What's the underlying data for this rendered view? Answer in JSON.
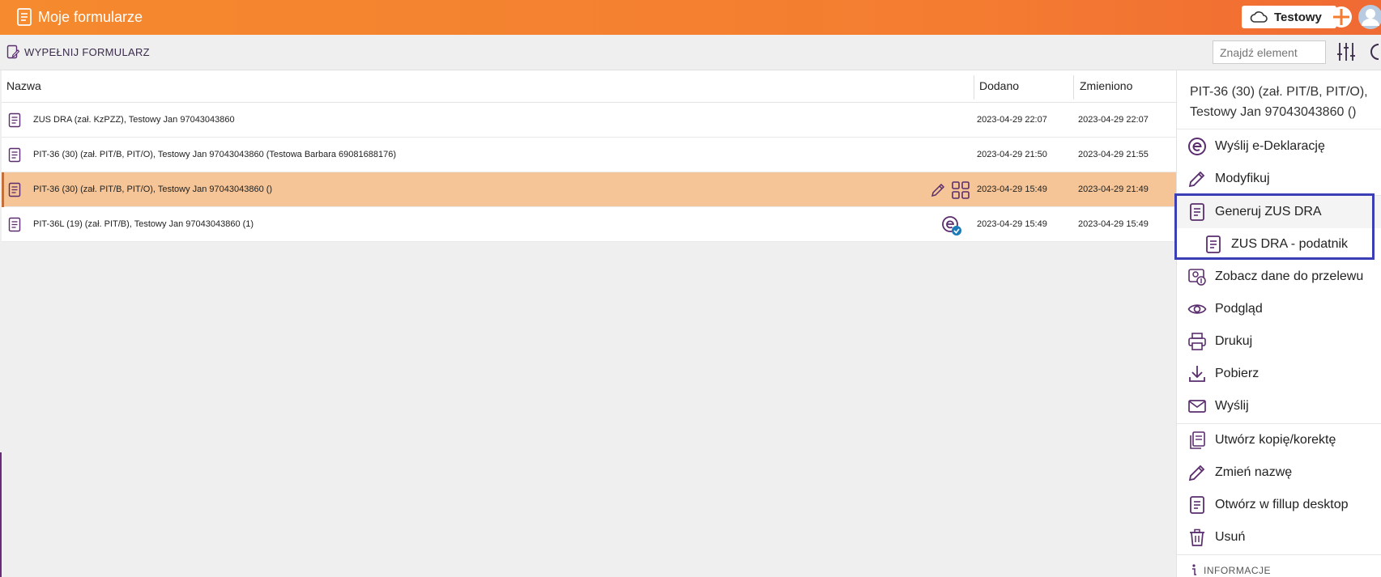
{
  "header": {
    "app_title": "Moje formularze",
    "account_label": "Testowy"
  },
  "toolbar": {
    "fill_form_label": "WYPEŁNIJ FORMULARZ",
    "search_placeholder": "Znajdź element"
  },
  "table": {
    "columns": {
      "name": "Nazwa",
      "added": "Dodano",
      "changed": "Zmieniono"
    },
    "rows": [
      {
        "name": "ZUS DRA (zał. KzPZZ), Testowy Jan 97043043860",
        "added": "2023-04-29 22:07",
        "changed": "2023-04-29 22:07"
      },
      {
        "name": "PIT-36 (30) (zał. PIT/B, PIT/O), Testowy Jan 97043043860 (Testowa Barbara 69081688176)",
        "added": "2023-04-29 21:50",
        "changed": "2023-04-29 21:55"
      },
      {
        "name": "PIT-36 (30) (zał. PIT/B, PIT/O), Testowy Jan 97043043860 ()",
        "added": "2023-04-29 15:49",
        "changed": "2023-04-29 21:49"
      },
      {
        "name": "PIT-36L (19) (zał. PIT/B), Testowy Jan 97043043860 (1)",
        "added": "2023-04-29 15:49",
        "changed": "2023-04-29 15:49"
      }
    ]
  },
  "panel": {
    "title": "PIT-36 (30) (zał. PIT/B, PIT/O), Testowy Jan 97043043860 ()",
    "items": {
      "send_edeclaration": "Wyślij e-Deklarację",
      "modify": "Modyfikuj",
      "generate_zus_dra": "Generuj ZUS DRA",
      "zus_dra_taxpayer": "ZUS DRA - podatnik",
      "transfer_data": "Zobacz dane do przelewu",
      "preview": "Podgląd",
      "print": "Drukuj",
      "download": "Pobierz",
      "send": "Wyślij",
      "copy_correct": "Utwórz kopię/korektę",
      "rename": "Zmień nazwę",
      "open_desktop": "Otwórz w fillup desktop",
      "delete": "Usuń"
    },
    "info_label": "INFORMACJE"
  },
  "colors": {
    "accent": "#f47c31",
    "icon_purple": "#5a2d6e",
    "selected_row": "#f5c597",
    "focus_border": "#3a3fb5"
  }
}
